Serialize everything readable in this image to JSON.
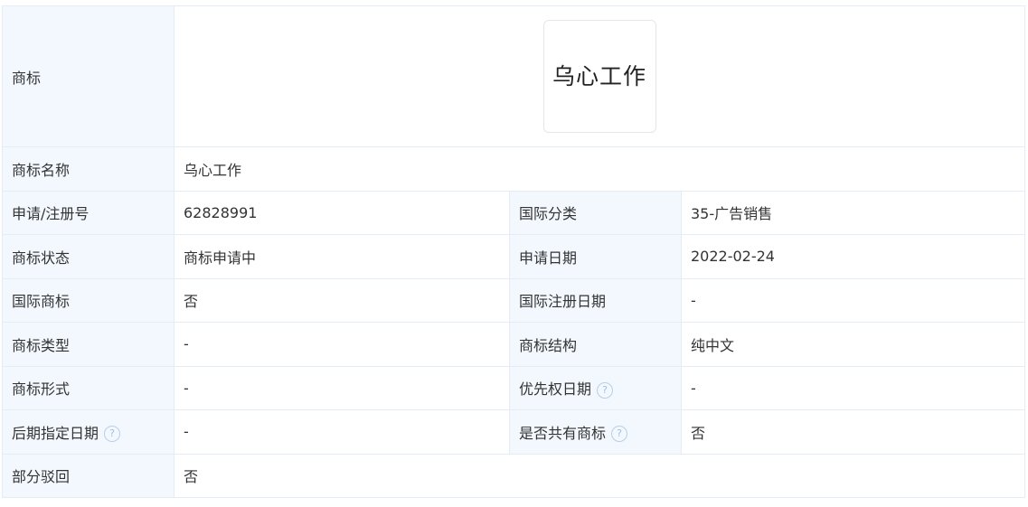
{
  "trademark": {
    "label": "商标",
    "logo_text": "乌心工作"
  },
  "name": {
    "label": "商标名称",
    "value": "乌心工作"
  },
  "rows": [
    {
      "l1": "申请/注册号",
      "v1": "62828991",
      "l2": "国际分类",
      "v2": "35-广告销售"
    },
    {
      "l1": "商标状态",
      "v1": "商标申请中",
      "l2": "申请日期",
      "v2": "2022-02-24"
    },
    {
      "l1": "国际商标",
      "v1": "否",
      "l2": "国际注册日期",
      "v2": "-"
    },
    {
      "l1": "商标类型",
      "v1": "-",
      "l2": "商标结构",
      "v2": "纯中文"
    },
    {
      "l1": "商标形式",
      "v1": "-",
      "l2": "优先权日期",
      "v2": "-"
    },
    {
      "l1": "后期指定日期",
      "v1": "-",
      "l2": "是否共有商标",
      "v2": "否"
    }
  ],
  "partial_reject": {
    "label": "部分驳回",
    "value": "否"
  },
  "help_icon_glyph": "?",
  "colors": {
    "label_bg": "#f2f8fe",
    "border": "#e4edf5",
    "help_icon": "#9fbde0"
  }
}
